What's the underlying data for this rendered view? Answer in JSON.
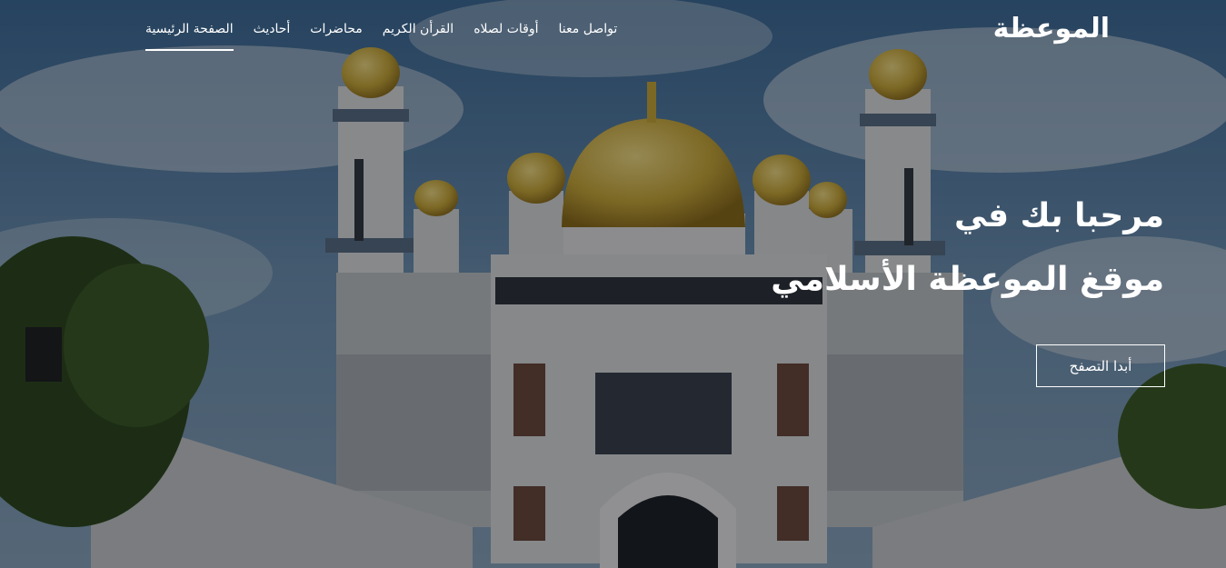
{
  "brand": {
    "logo_text": "الموعظة"
  },
  "nav": {
    "items": [
      {
        "label": "الصفحة الرئيسية",
        "active": true
      },
      {
        "label": "أحاديث",
        "active": false
      },
      {
        "label": "محاضرات",
        "active": false
      },
      {
        "label": "القرأن الكريم",
        "active": false
      },
      {
        "label": "أوقات لصلاه",
        "active": false
      },
      {
        "label": "تواصل معنا",
        "active": false
      }
    ]
  },
  "hero": {
    "line1": "مرحبا بك في",
    "line2": "موقغ الموعظة الأسلامي",
    "cta_label": "أبدا التصفح"
  },
  "colors": {
    "overlay": "#000000",
    "dome_gold": "#c9a93c",
    "text": "#ffffff"
  }
}
